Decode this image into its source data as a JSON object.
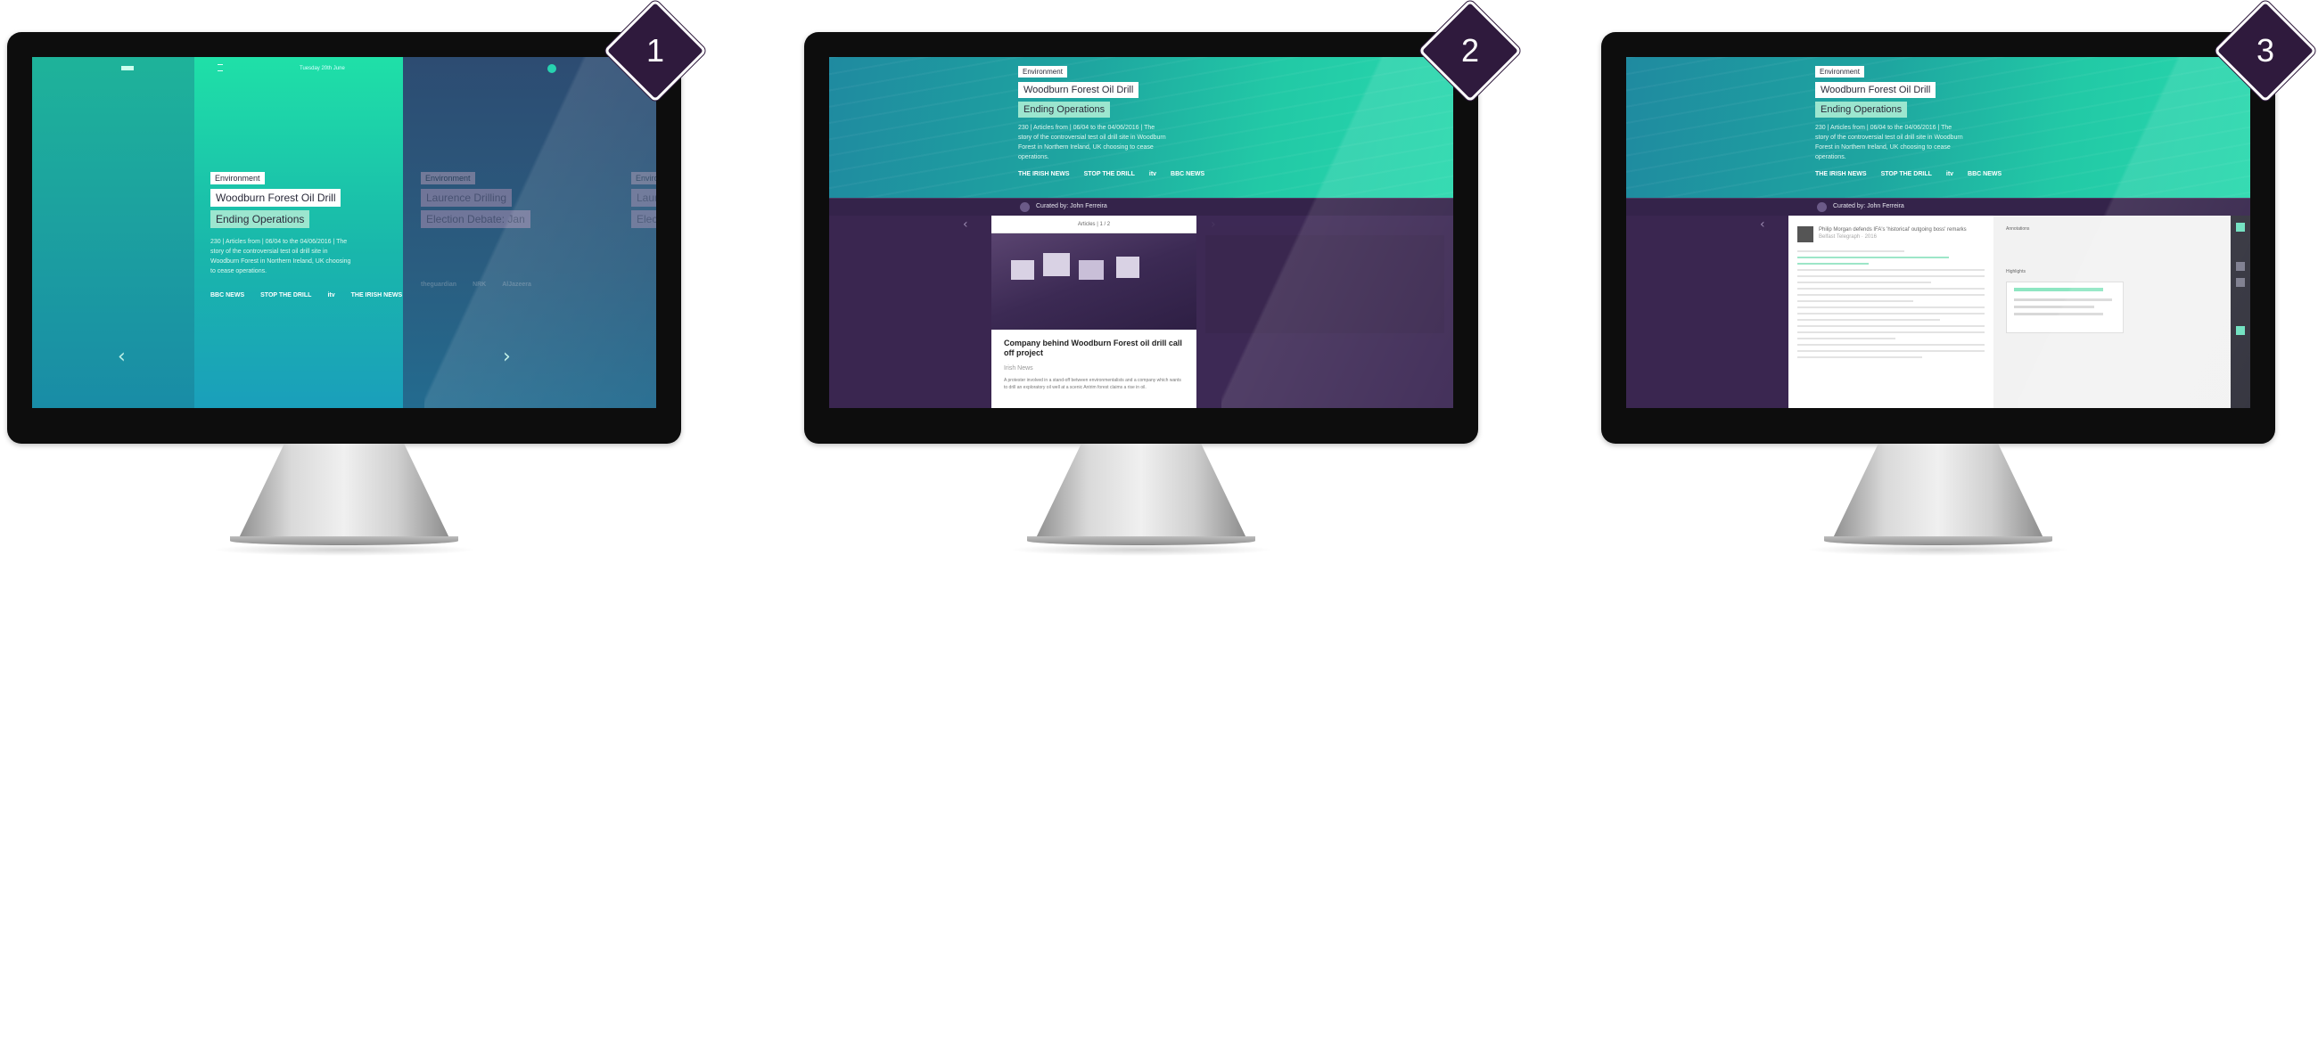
{
  "monitors": [
    {
      "badge": "1",
      "topbar": {
        "date": "Tuesday 20th June"
      },
      "story": {
        "tag": "Environment",
        "title_line1": "Woodburn Forest Oil Drill",
        "title_line2": "Ending Operations",
        "description": "230 | Articles from | 06/04 to the 04/06/2016 | The story of the controversial test oil drill site in Woodburn Forest in Northern Ireland, UK choosing to cease operations.",
        "logos": [
          "BBC NEWS",
          "STOP THE DRILL",
          "itv",
          "THE IRISH NEWS"
        ]
      },
      "ghost_story": {
        "tag": "Environment",
        "title_line1": "Laurence Drilling",
        "title_line2": "Election Debate: Jan",
        "logos": [
          "theguardian",
          "NRK",
          "AlJazeera"
        ]
      },
      "ghost_story_2": {
        "tag": "Environ",
        "title_line1": "Laur",
        "title_line2": "Elec"
      },
      "arrow_left": "‹",
      "arrow_right": "›"
    },
    {
      "badge": "2",
      "story": {
        "tag": "Environment",
        "title_line1": "Woodburn Forest Oil Drill",
        "title_line2": "Ending Operations",
        "description": "230 | Articles from | 06/04 to the 04/06/2016 | The story of the controversial test oil drill site in Woodburn Forest in Northern Ireland, UK choosing to cease operations.",
        "logos": [
          "THE IRISH NEWS",
          "STOP THE DRILL",
          "itv",
          "BBC NEWS"
        ]
      },
      "curated_by": "Curated by: John Ferreira",
      "card": {
        "header": "Articles | 1 / 2",
        "title": "Company behind Woodburn Forest oil drill call off project",
        "source": "Irish News",
        "body": "A protester involved in a stand-off between environmentalists and a company which wants to drill an exploratory oil well at a scenic Antrim forest claims a rise in oil."
      },
      "arrow_left": "‹",
      "arrow_right": "›"
    },
    {
      "badge": "3",
      "story": {
        "tag": "Environment",
        "title_line1": "Woodburn Forest Oil Drill",
        "title_line2": "Ending Operations",
        "description": "230 | Articles from | 06/04 to the 04/06/2016 | The story of the controversial test oil drill site in Woodburn Forest in Northern Ireland, UK choosing to cease operations.",
        "logos": [
          "THE IRISH NEWS",
          "STOP THE DRILL",
          "itv",
          "BBC NEWS"
        ]
      },
      "curated_by": "Curated by: John Ferreira",
      "doc": {
        "headline": "Philip Morgan defends IFA's 'historical' outgoing boss' remarks",
        "meta": "Belfast Telegraph · 2016"
      },
      "annotation": {
        "heading": "Annotations",
        "label": "Highlights"
      },
      "arrow_left": "‹"
    }
  ],
  "colors": {
    "badge_bg": "#2f1a3d",
    "accent_teal": "#1fe0a8",
    "curated_bar": "#34234a",
    "lower_purple": "#3b2750"
  }
}
